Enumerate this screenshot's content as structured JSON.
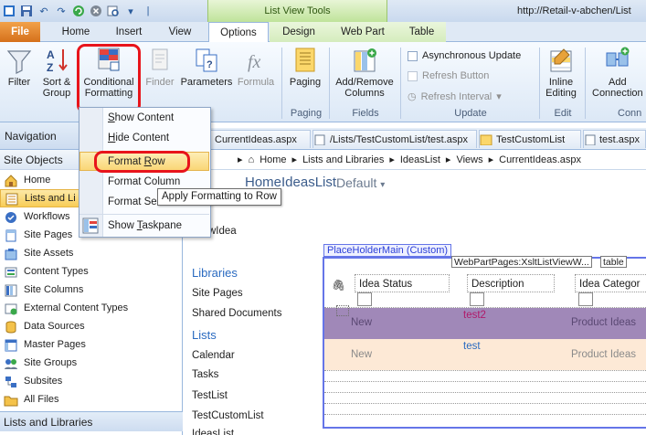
{
  "window": {
    "title": "http://Retail-v-abchen/List",
    "context_band": "List View Tools"
  },
  "tabs": [
    {
      "label": "File"
    },
    {
      "label": "Home"
    },
    {
      "label": "Insert"
    },
    {
      "label": "View"
    },
    {
      "label": "Options"
    },
    {
      "label": "Design"
    },
    {
      "label": "Web Part"
    },
    {
      "label": "Table"
    }
  ],
  "ribbon": {
    "filter": "Filter",
    "sort_group": [
      "Sort &",
      "Group"
    ],
    "conditional_formatting": [
      "Conditional",
      "Formatting"
    ],
    "finder": "Finder",
    "parameters": "Parameters",
    "formula": "Formula",
    "paging": "Paging",
    "add_remove_columns": [
      "Add/Remove",
      "Columns"
    ],
    "async_update": "Asynchronous Update",
    "refresh_button": "Refresh Button",
    "refresh_interval": "Refresh Interval",
    "inline_editing": [
      "Inline",
      "Editing"
    ],
    "add_connection": [
      "Add",
      "Connection"
    ],
    "groups": {
      "paging": "Paging",
      "fields": "Fields",
      "update": "Update",
      "edit": "Edit",
      "conn": "Conn"
    }
  },
  "menu": {
    "show_content": {
      "pre": "",
      "u": "S",
      "post": "how Content"
    },
    "hide_content": {
      "pre": "",
      "u": "H",
      "post": "ide Content"
    },
    "format_row": {
      "pre": "Format ",
      "u": "R",
      "post": "ow"
    },
    "format_column": "Format Column",
    "format_selection": "Format Se",
    "show_taskpane": {
      "pre": "Show ",
      "u": "T",
      "post": "askpane"
    },
    "tooltip": "Apply Formatting to Row"
  },
  "nav": {
    "header": "Navigation",
    "site_objects": "Site Objects",
    "items": [
      "Home",
      "Lists and Li",
      "Workflows",
      "Site Pages",
      "Site Assets",
      "Content Types",
      "Site Columns",
      "External Content Types",
      "Data Sources",
      "Master Pages",
      "Site Groups",
      "Subsites",
      "All Files"
    ],
    "bottom": "Lists and Libraries"
  },
  "doc_tabs": [
    "CurrentIdeas.aspx",
    "/Lists/TestCustomList/test.aspx",
    "TestCustomList",
    "test.aspx"
  ],
  "breadcrumb": [
    "Home",
    "Lists and Libraries",
    "IdeasList",
    "Views",
    "CurrentIdeas.aspx"
  ],
  "page": {
    "title": "HomeIdeasList",
    "view": "Default"
  },
  "design": {
    "new_idea": "wIdea",
    "libraries_header": "Libraries",
    "library_links": [
      "Site Pages",
      "Shared Documents"
    ],
    "lists_header": "Lists",
    "list_links": [
      "Calendar",
      "Tasks",
      "TestList",
      "TestCustomList",
      "IdeasList"
    ],
    "placeholder": "PlaceHolderMain (Custom)",
    "webpart_label": "WebPartPages:XsltListViewW...",
    "table_label": "table",
    "columns": [
      "Idea Status",
      "Description",
      "Idea Categor"
    ],
    "rows": [
      {
        "status": "New",
        "description": "test2",
        "category": "Product Ideas"
      },
      {
        "status": "New",
        "description": "test",
        "category": "Product Ideas"
      }
    ]
  },
  "colors": {
    "row1_bg": "#a088b8",
    "row2_bg": "#fde9d6",
    "highlight": "#e8141b",
    "accent": "#2a6ac0"
  }
}
